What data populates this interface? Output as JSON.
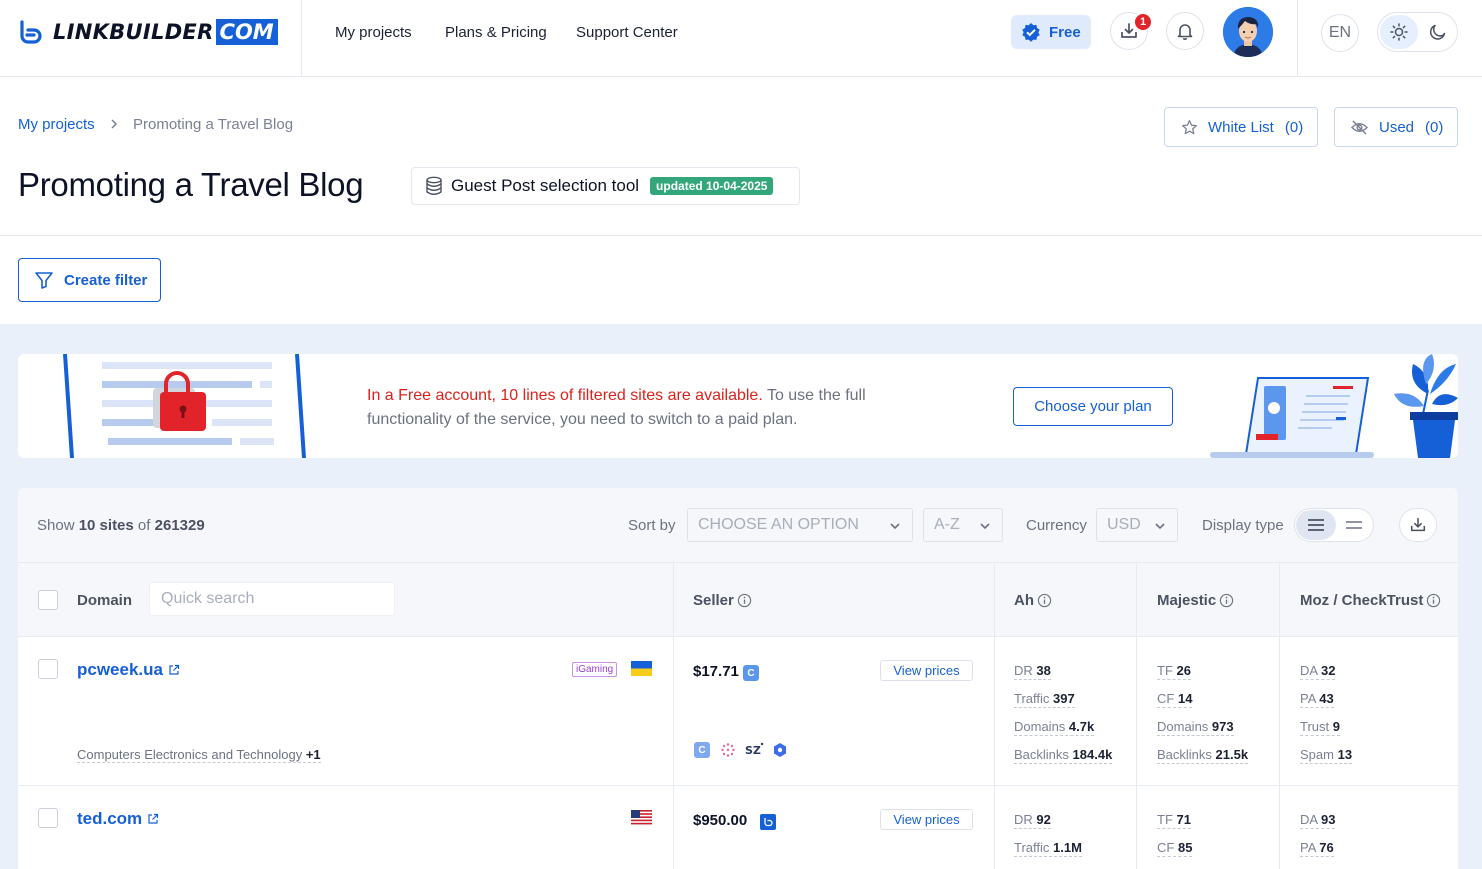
{
  "header": {
    "logo_text": "LINKBUILDER",
    "logo_com": "COM",
    "nav": [
      "My projects",
      "Plans & Pricing",
      "Support Center"
    ],
    "plan_label": "Free",
    "download_badge": "1",
    "language": "EN"
  },
  "breadcrumb": {
    "root": "My projects",
    "current": "Promoting a Travel Blog"
  },
  "lists": {
    "white_list_label": "White List",
    "white_list_count": "(0)",
    "used_label": "Used",
    "used_count": "(0)"
  },
  "page": {
    "title": "Promoting a Travel Blog",
    "tool_label": "Guest Post selection tool",
    "updated_badge": "updated 10-04-2025"
  },
  "filter": {
    "create_label": "Create filter"
  },
  "banner": {
    "highlight": "In a Free account, 10 lines of filtered sites are available.",
    "text": " To use the full functionality of the service, you need to switch to a paid plan.",
    "button": "Choose your plan"
  },
  "toolbar": {
    "show_prefix": "Show ",
    "show_count": "10 sites",
    "show_of": " of ",
    "total": "261329",
    "sort_label": "Sort by",
    "sort_placeholder": "CHOOSE AN OPTION",
    "order_value": "A-Z",
    "currency_label": "Currency",
    "currency_value": "USD",
    "display_label": "Display type"
  },
  "table": {
    "headers": {
      "domain": "Domain",
      "search_placeholder": "Quick search",
      "seller": "Seller",
      "ah": "Ah",
      "majestic": "Majestic",
      "moz": "Moz / CheckTrust"
    },
    "rows": [
      {
        "domain": "pcweek.ua",
        "tag": "iGaming",
        "flag": "ukraine-flag",
        "category": "Computers Electronics and Technology",
        "category_more": "+1",
        "price": "$17.71",
        "view_prices": "View prices",
        "ah": {
          "dr_label": "DR",
          "dr": "38",
          "traffic_label": "Traffic",
          "traffic": "397",
          "domains_label": "Domains",
          "domains": "4.7k",
          "backlinks_label": "Backlinks",
          "backlinks": "184.4k"
        },
        "majestic": {
          "tf_label": "TF",
          "tf": "26",
          "cf_label": "CF",
          "cf": "14",
          "domains_label": "Domains",
          "domains": "973",
          "backlinks_label": "Backlinks",
          "backlinks": "21.5k"
        },
        "moz": {
          "da_label": "DA",
          "da": "32",
          "pa_label": "PA",
          "pa": "43",
          "trust_label": "Trust",
          "trust": "9",
          "spam_label": "Spam",
          "spam": "13"
        }
      },
      {
        "domain": "ted.com",
        "flag": "usa-flag",
        "price": "$950.00",
        "view_prices": "View prices",
        "ah": {
          "dr_label": "DR",
          "dr": "92",
          "traffic_label": "Traffic",
          "traffic": "1.1M"
        },
        "majestic": {
          "tf_label": "TF",
          "tf": "71",
          "cf_label": "CF",
          "cf": "85"
        },
        "moz": {
          "da_label": "DA",
          "da": "93",
          "pa_label": "PA",
          "pa": "76"
        }
      }
    ]
  },
  "colors": {
    "accent": "#1560d6",
    "alert": "#d9241c",
    "success_badge": "#34a77a",
    "background_grey": "#eaf0f9"
  }
}
